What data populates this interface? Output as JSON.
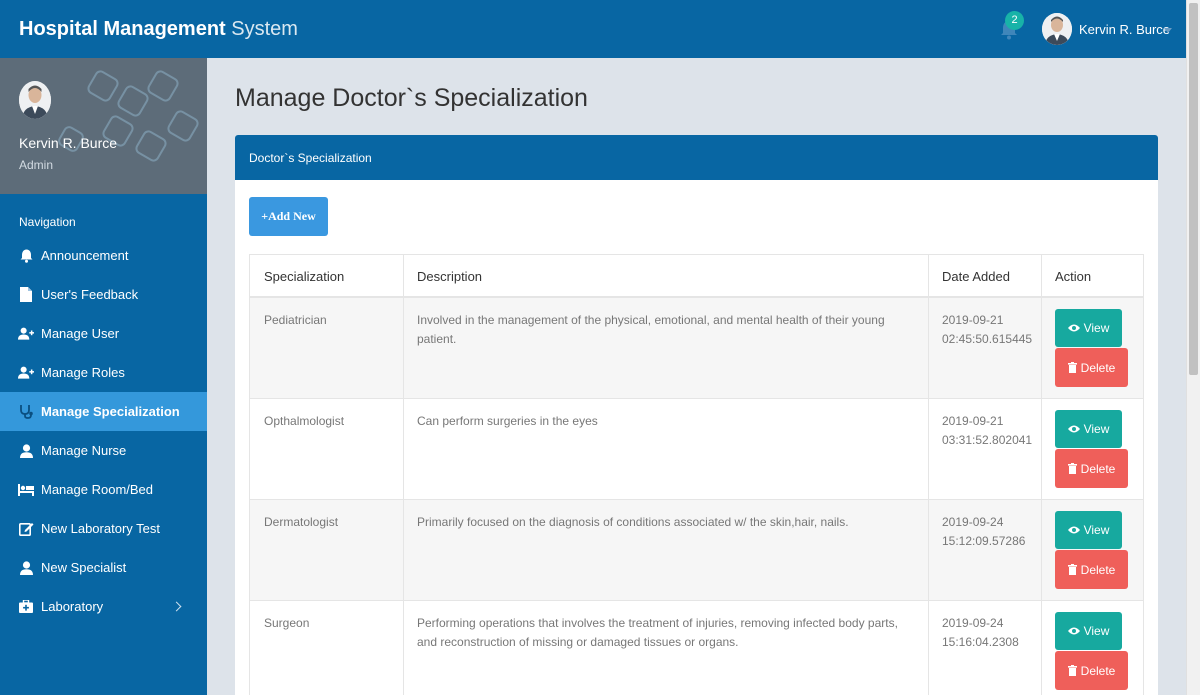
{
  "header": {
    "brand_bold": "Hospital Management",
    "brand_light": " System",
    "notification_count": "2",
    "user_name": "Kervin R. Burce"
  },
  "sidebar": {
    "profile_name": "Kervin R. Burce",
    "profile_role": "Admin",
    "nav_title": "Navigation",
    "items": [
      {
        "label": "Announcement",
        "icon": "bell-icon"
      },
      {
        "label": "User's Feedback",
        "icon": "file-icon"
      },
      {
        "label": "Manage User",
        "icon": "user-plus-icon"
      },
      {
        "label": "Manage Roles",
        "icon": "user-plus-icon"
      },
      {
        "label": "Manage Specialization",
        "icon": "stethoscope-icon",
        "active": true
      },
      {
        "label": "Manage Nurse",
        "icon": "user-icon"
      },
      {
        "label": "Manage Room/Bed",
        "icon": "bed-icon"
      },
      {
        "label": "New Laboratory Test",
        "icon": "edit-icon"
      },
      {
        "label": "New Specialist",
        "icon": "user-icon"
      },
      {
        "label": "Laboratory",
        "icon": "medkit-icon",
        "has_submenu": true
      }
    ]
  },
  "main": {
    "page_title": "Manage Doctor`s Specialization",
    "panel_title": "Doctor`s Specialization",
    "add_button": "Add New",
    "columns": [
      "Specialization",
      "Description",
      "Date Added",
      "Action"
    ],
    "rows": [
      {
        "specialization": "Pediatrician",
        "description_1": "Involved in the management of the physical, emotional, and mental health of their young",
        "description_2": "patient.",
        "date_1": "2019-09-21",
        "date_2": "02:45:50.615445"
      },
      {
        "specialization": "Opthalmologist",
        "description_1": "Can perform surgeries in the eyes",
        "description_2": "",
        "date_1": "2019-09-21",
        "date_2": "03:31:52.802041"
      },
      {
        "specialization": "Dermatologist",
        "description_1": "Primarily focused on the diagnosis of conditions associated w/ the skin,hair, nails.",
        "description_2": "",
        "date_1": "2019-09-24",
        "date_2": "15:12:09.57286"
      },
      {
        "specialization": "Surgeon",
        "description_1": "Performing operations that involves the treatment of injuries, removing infected body parts,",
        "description_2": "and reconstruction of missing or damaged tissues or organs.",
        "date_1": "2019-09-24",
        "date_2": "15:16:04.2308"
      }
    ],
    "view_label": "View",
    "delete_label": "Delete"
  },
  "colors": {
    "primary": "#0866a3",
    "active_nav": "#3498db",
    "view_button": "#17a99f",
    "delete_button": "#ef5f5a",
    "add_button": "#3a98e0"
  }
}
